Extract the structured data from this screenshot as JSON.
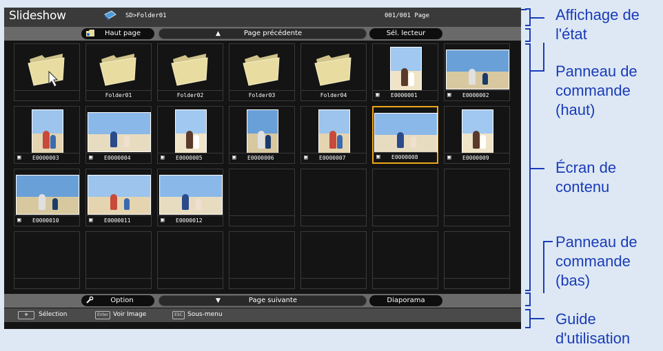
{
  "status": {
    "app_title": "Slideshow",
    "path": "SD>Folder01",
    "page_count": "001/001 Page"
  },
  "top_panel": {
    "home": "Haut page",
    "prev_page": "Page précédente",
    "select_drive": "Sél. lecteur"
  },
  "bottom_panel": {
    "option": "Option",
    "next_page": "Page suivante",
    "slideshow": "Diaporama"
  },
  "guide": {
    "select": "Sélection",
    "enter_key": "Enter",
    "view_image": "Voir Image",
    "esc_key": "ESC",
    "submenu": "Sous-menu"
  },
  "items": [
    {
      "type": "folder-up",
      "name": ""
    },
    {
      "type": "folder",
      "name": "Folder01"
    },
    {
      "type": "folder",
      "name": "Folder02"
    },
    {
      "type": "folder",
      "name": "Folder03"
    },
    {
      "type": "folder",
      "name": "Folder04"
    },
    {
      "type": "photo",
      "name": "E0000001",
      "orient": "portrait"
    },
    {
      "type": "photo",
      "name": "E0000002",
      "orient": "land"
    },
    {
      "type": "photo",
      "name": "E0000003",
      "orient": "portrait"
    },
    {
      "type": "photo",
      "name": "E0000004",
      "orient": "land"
    },
    {
      "type": "photo",
      "name": "E0000005",
      "orient": "portrait"
    },
    {
      "type": "photo",
      "name": "E0000006",
      "orient": "portrait"
    },
    {
      "type": "photo",
      "name": "E0000007",
      "orient": "portrait"
    },
    {
      "type": "photo",
      "name": "E0000008",
      "orient": "land",
      "selected": true
    },
    {
      "type": "photo",
      "name": "E0000009",
      "orient": "portrait"
    },
    {
      "type": "photo",
      "name": "E0000010",
      "orient": "land"
    },
    {
      "type": "photo",
      "name": "E0000011",
      "orient": "land"
    },
    {
      "type": "photo",
      "name": "E0000012",
      "orient": "land"
    }
  ],
  "callouts": {
    "status_display": "Affichage de l'état",
    "top_panel": "Panneau de commande (haut)",
    "content_screen": "Écran de contenu",
    "bottom_panel": "Panneau de commande (bas)",
    "guide": "Guide d'utilisation"
  },
  "colors": {
    "callout": "#1a3bb8",
    "selection": "#f0a818",
    "folder": "#e8dca0"
  }
}
